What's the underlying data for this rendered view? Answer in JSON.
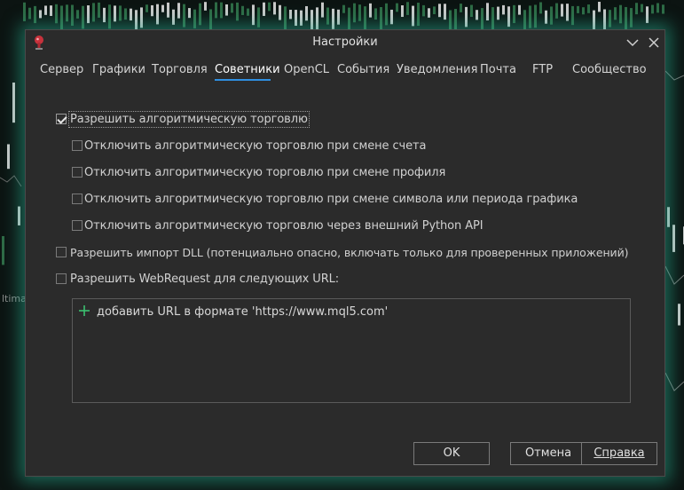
{
  "window": {
    "title": "Настройки"
  },
  "background": {
    "side_label": "ltima"
  },
  "tabs": [
    {
      "label": "Сервер",
      "active": false
    },
    {
      "label": "Графики",
      "active": false
    },
    {
      "label": "Торговля",
      "active": false
    },
    {
      "label": "Советники",
      "active": true
    },
    {
      "label": "OpenCL",
      "active": false
    },
    {
      "label": "События",
      "active": false
    },
    {
      "label": "Уведомления",
      "active": false
    },
    {
      "label": "Почта",
      "active": false
    },
    {
      "label": "FTP",
      "active": false
    },
    {
      "label": "Сообщество",
      "active": false
    }
  ],
  "options": {
    "allow_algo": {
      "label": "Разрешить алгоритмическую торговлю",
      "checked": true
    },
    "disable_on_account": {
      "label": "Отключить алгоритмическую торговлю при смене счета",
      "checked": false
    },
    "disable_on_profile": {
      "label": "Отключить алгоритмическую торговлю при смене профиля",
      "checked": false
    },
    "disable_on_symbol": {
      "label": "Отключить алгоритмическую торговлю при смене символа или периода графика",
      "checked": false
    },
    "disable_python": {
      "label": "Отключить алгоритмическую торговлю через внешний Python API",
      "checked": false
    },
    "allow_dll": {
      "label": "Разрешить импорт DLL (потенциально опасно, включать только для проверенных приложений)",
      "checked": false
    },
    "allow_webrequest": {
      "label": "Разрешить WebRequest для следующих URL:",
      "checked": false
    }
  },
  "url_list": {
    "add_text": "добавить URL в формате 'https://www.mql5.com'"
  },
  "buttons": {
    "ok": "OK",
    "cancel": "Отмена",
    "help": "Справка"
  },
  "colors": {
    "accent": "#2f8fe0",
    "add_icon": "#3cc070",
    "dialog_bg": "#2b2b2b",
    "glow": "#28aa8c"
  },
  "icons": {
    "app": "terminal-app-icon",
    "minimize": "chevron-down-icon",
    "close": "close-icon",
    "add": "plus-icon"
  }
}
